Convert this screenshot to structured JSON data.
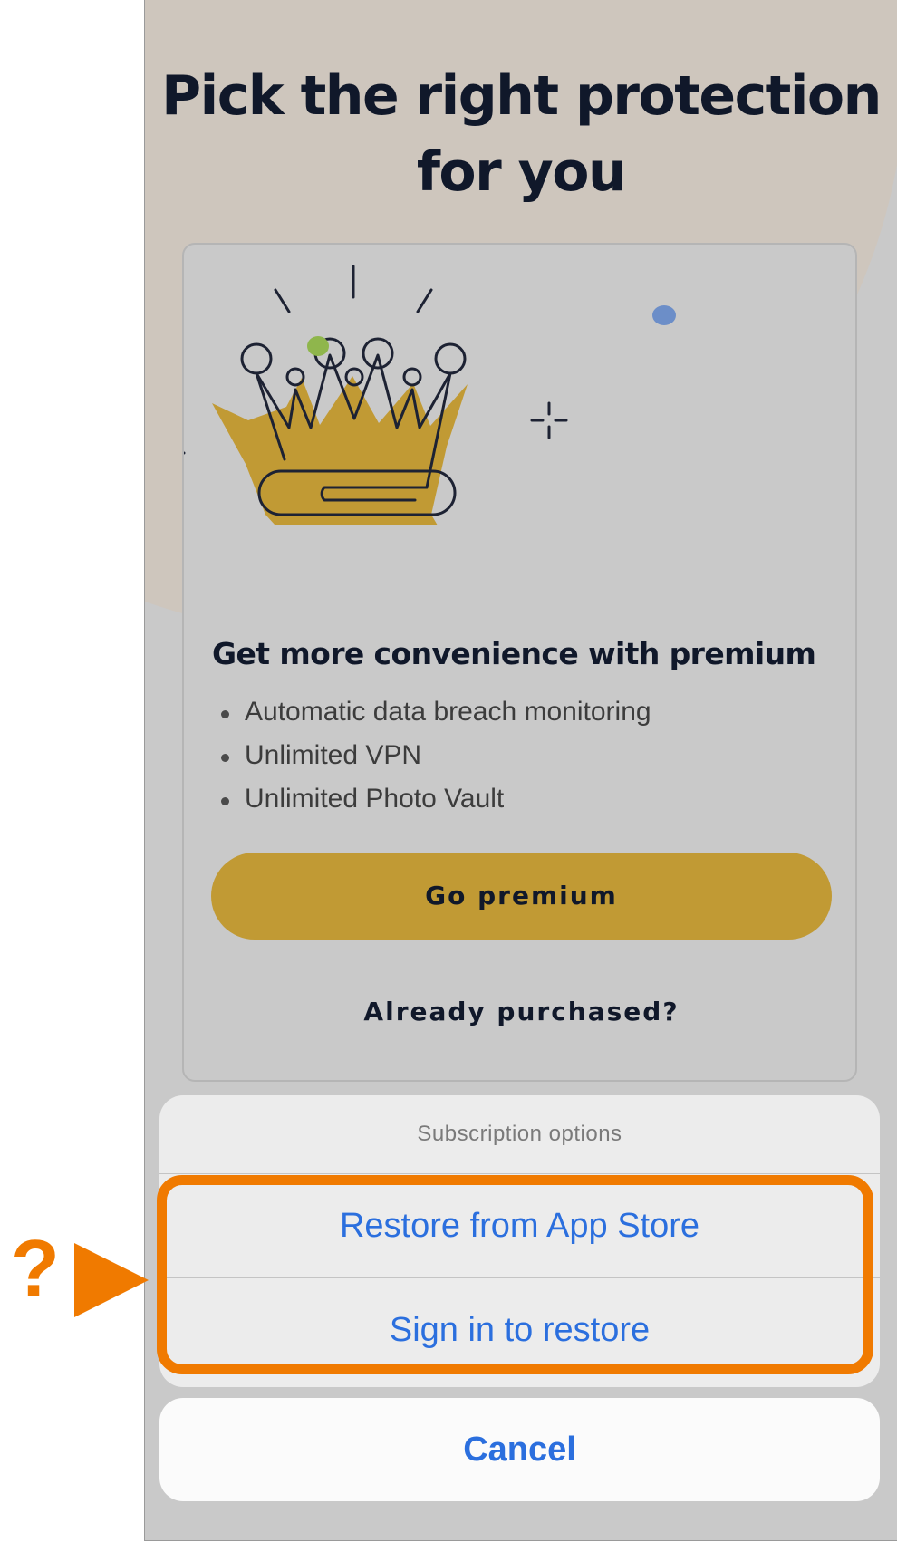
{
  "page": {
    "headline_line1": "Pick the right protection",
    "headline_line2": "for you"
  },
  "premium_card": {
    "illustration": "crown-icon",
    "title": "Get more convenience with premium",
    "features": [
      "Automatic data breach monitoring",
      "Unlimited VPN",
      "Unlimited Photo Vault"
    ],
    "go_premium_label": "Go premium",
    "already_purchased_label": "Already purchased?"
  },
  "action_sheet": {
    "title": "Subscription options",
    "options": [
      "Restore from App Store",
      "Sign in to restore"
    ],
    "cancel_label": "Cancel"
  },
  "annotation": {
    "marker": "?",
    "color": "#f07a00"
  },
  "colors": {
    "accent_gold": "#c19a34",
    "link_blue": "#2b6fde",
    "text_dark": "#10182a"
  }
}
